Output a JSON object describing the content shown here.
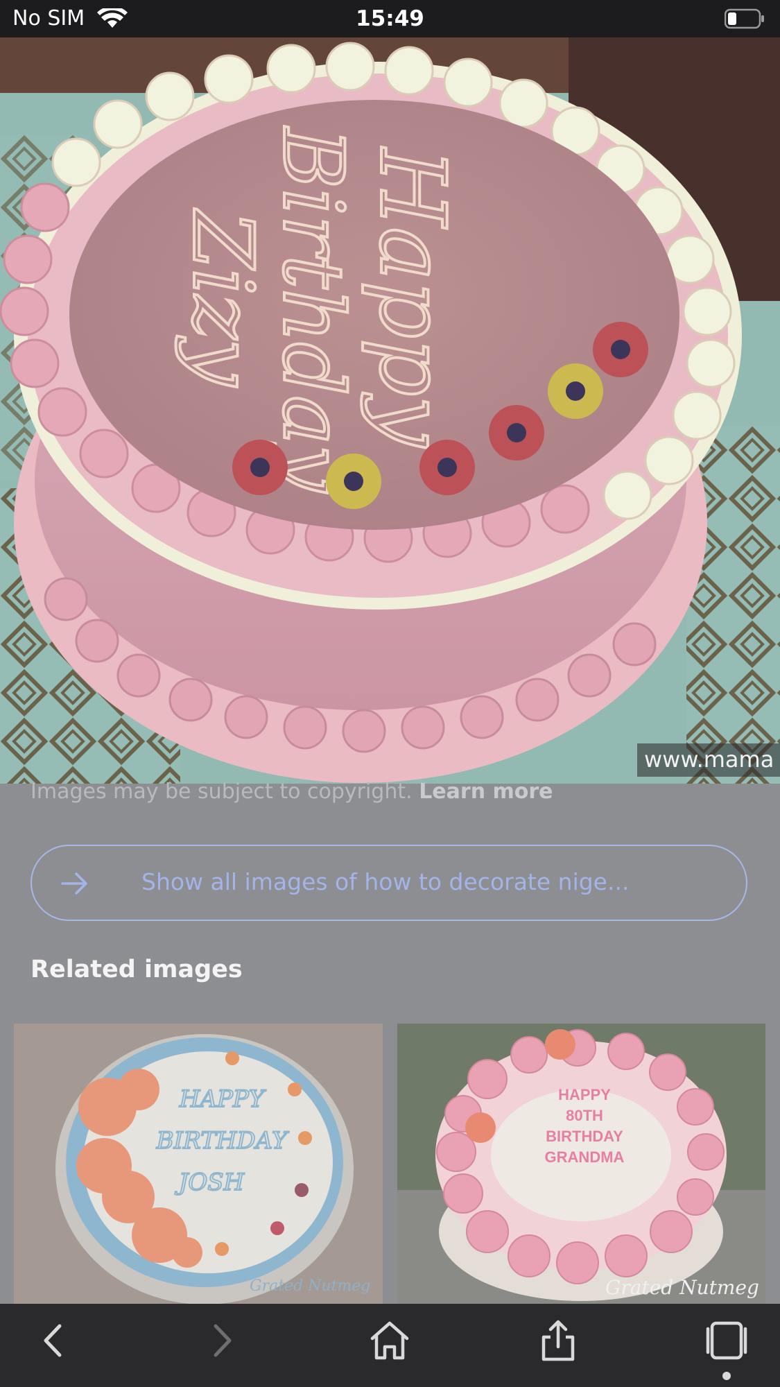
{
  "status_bar": {
    "carrier": "No SIM",
    "time": "15:49",
    "icons": [
      "wifi-icon",
      "battery-icon"
    ]
  },
  "hero_image": {
    "description_icon": "birthday-cake-photo",
    "cake_text_lines": [
      "Happy",
      "Birthday",
      "Zizy"
    ],
    "watermark": "www.mama"
  },
  "copyright": {
    "text": "Images may be subject to copyright. ",
    "link": "Learn more"
  },
  "show_all_button": {
    "label": "Show all images of how to decorate nige...",
    "icon": "arrow-right-icon"
  },
  "related": {
    "title": "Related images",
    "items": [
      {
        "icon": "cake-photo",
        "cake_text_lines": [
          "HAPPY",
          "BIRTHDAY",
          "JOSH"
        ],
        "watermark": "Grated Nutmeg"
      },
      {
        "icon": "cake-photo",
        "cake_text_lines": [
          "HAPPY",
          "80TH",
          "BIRTHDAY",
          "GRANDMA"
        ],
        "watermark": "Grated Nutmeg"
      }
    ]
  },
  "toolbar": {
    "items": [
      "back-icon",
      "forward-icon",
      "home-icon",
      "share-icon",
      "tabs-icon"
    ]
  },
  "colors": {
    "status_bar_bg": "#1c1c1e",
    "page_bg": "#8d8e92",
    "button_border": "#a8b8e6",
    "button_text": "#a3b4e8",
    "toolbar_bg": "#2a2a2d"
  }
}
